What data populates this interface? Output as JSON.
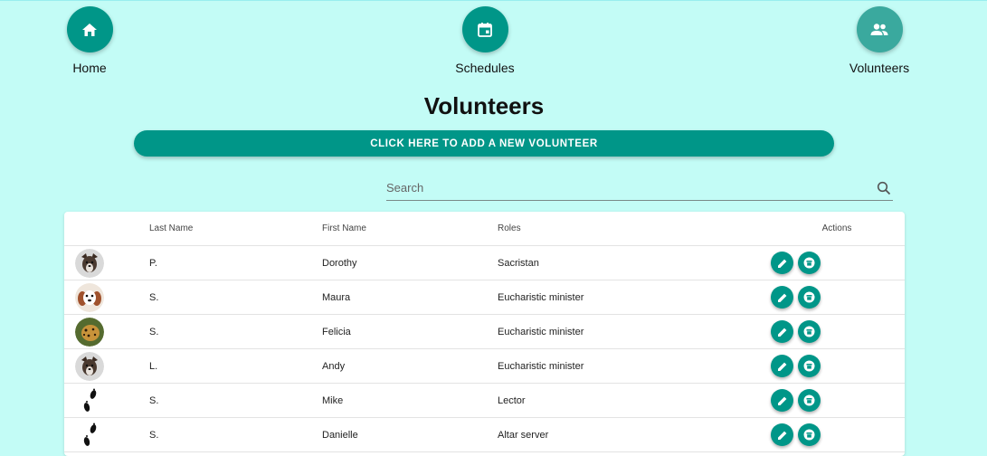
{
  "colors": {
    "accent": "#009688",
    "accent_light": "#3aa99e",
    "background": "#c3fcf6"
  },
  "nav": {
    "home": {
      "label": "Home",
      "icon": "home-icon"
    },
    "schedules": {
      "label": "Schedules",
      "icon": "calendar-icon"
    },
    "volunteers": {
      "label": "Volunteers",
      "icon": "people-icon",
      "active": true
    }
  },
  "page": {
    "title": "Volunteers"
  },
  "add_button": {
    "label": "CLICK HERE TO ADD A NEW VOLUNTEER"
  },
  "search": {
    "placeholder": "Search",
    "value": ""
  },
  "table": {
    "headers": {
      "avatar": "",
      "last_name": "Last Name",
      "first_name": "First Name",
      "roles": "Roles",
      "actions": "Actions"
    },
    "rows": [
      {
        "avatar": "dog-photo",
        "last_name": "P.",
        "first_name": "Dorothy",
        "roles": "Sacristan"
      },
      {
        "avatar": "puppy-photo",
        "last_name": "S.",
        "first_name": "Maura",
        "roles": "Eucharistic minister"
      },
      {
        "avatar": "leopard-photo",
        "last_name": "S.",
        "first_name": "Felicia",
        "roles": "Eucharistic minister"
      },
      {
        "avatar": "dog-photo",
        "last_name": "L.",
        "first_name": "Andy",
        "roles": "Eucharistic minister"
      },
      {
        "avatar": "footprints-icon",
        "last_name": "S.",
        "first_name": "Mike",
        "roles": "Lector"
      },
      {
        "avatar": "footprints-icon",
        "last_name": "S.",
        "first_name": "Danielle",
        "roles": "Altar server"
      }
    ]
  }
}
